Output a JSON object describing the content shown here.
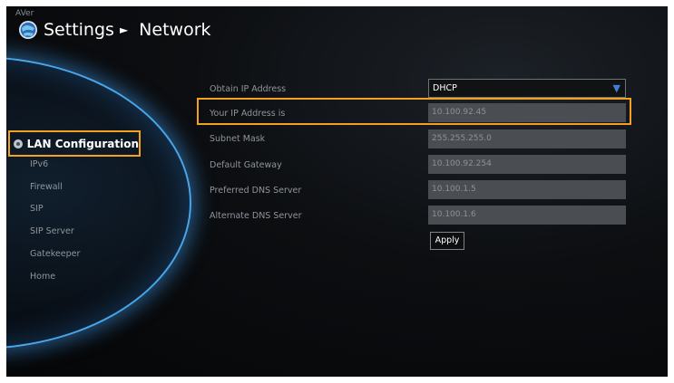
{
  "header": {
    "brand": "AVer",
    "section": "Settings",
    "separator": "►",
    "page": "Network"
  },
  "sidebar": {
    "items": [
      {
        "label": "LAN Configuration",
        "active": true
      },
      {
        "label": "IPv6"
      },
      {
        "label": "Firewall"
      },
      {
        "label": "SIP"
      },
      {
        "label": "SIP Server"
      },
      {
        "label": "Gatekeeper"
      },
      {
        "label": "Home"
      }
    ]
  },
  "form": {
    "obtain_ip": {
      "label": "Obtain IP Address",
      "value": "DHCP",
      "arrow": "▼"
    },
    "ip_address": {
      "label": "Your IP Address is",
      "value": "10.100.92.45"
    },
    "subnet_mask": {
      "label": "Subnet Mask",
      "value": "255.255.255.0"
    },
    "default_gateway": {
      "label": "Default Gateway",
      "value": "10.100.92.254"
    },
    "preferred_dns": {
      "label": "Preferred DNS Server",
      "value": "10.100.1.5"
    },
    "alternate_dns": {
      "label": "Alternate DNS Server",
      "value": "10.100.1.6"
    },
    "apply_label": "Apply"
  },
  "colors": {
    "highlight": "#f3a21f",
    "accent_glow": "#4aa6e8",
    "dropdown_arrow": "#3f7fd8"
  }
}
